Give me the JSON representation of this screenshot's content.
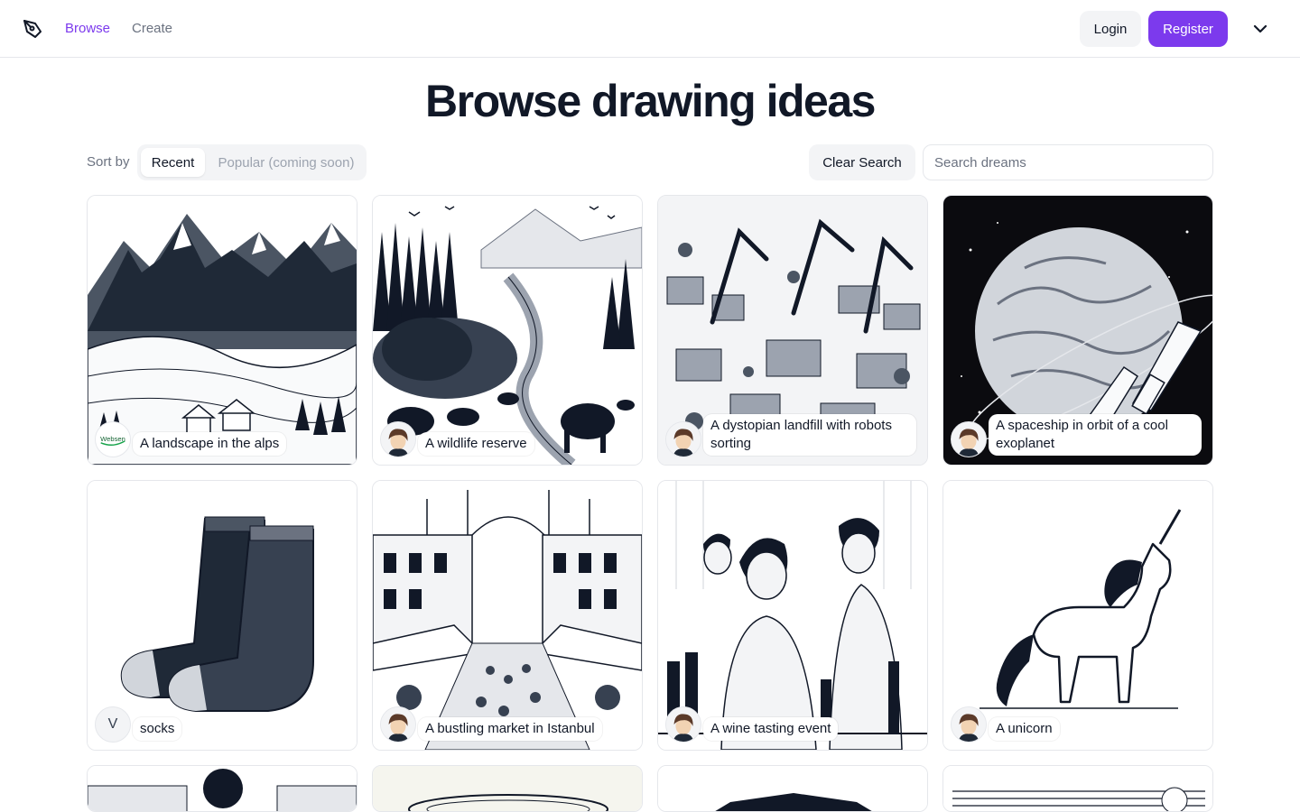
{
  "nav": {
    "browse_label": "Browse",
    "create_label": "Create",
    "login_label": "Login",
    "register_label": "Register"
  },
  "page": {
    "title": "Browse drawing ideas"
  },
  "controls": {
    "sort_label": "Sort by",
    "sort_options": [
      "Recent",
      "Popular (coming soon)"
    ],
    "sort_selected": "Recent",
    "clear_label": "Clear Search",
    "search_placeholder": "Search dreams",
    "search_value": ""
  },
  "cards": [
    {
      "caption": "A landscape in the alps",
      "avatar": "websen-logo",
      "avatar_text": "Websen"
    },
    {
      "caption": "A wildlife reserve",
      "avatar": "anime-boy-avatar"
    },
    {
      "caption": "A dystopian landfill with robots sorting",
      "avatar": "anime-boy-avatar"
    },
    {
      "caption": "A spaceship in orbit of a cool exoplanet",
      "avatar": "anime-boy-avatar"
    },
    {
      "caption": "socks",
      "avatar": "letter-avatar",
      "avatar_text": "V"
    },
    {
      "caption": "A bustling market in Istanbul",
      "avatar": "anime-boy-avatar"
    },
    {
      "caption": "A wine tasting event",
      "avatar": "anime-boy-avatar"
    },
    {
      "caption": "A unicorn",
      "avatar": "anime-boy-avatar"
    }
  ],
  "colors": {
    "accent": "#7c3aed",
    "muted": "#6b7280",
    "surface": "#f3f4f6",
    "border": "#e5e7eb"
  }
}
